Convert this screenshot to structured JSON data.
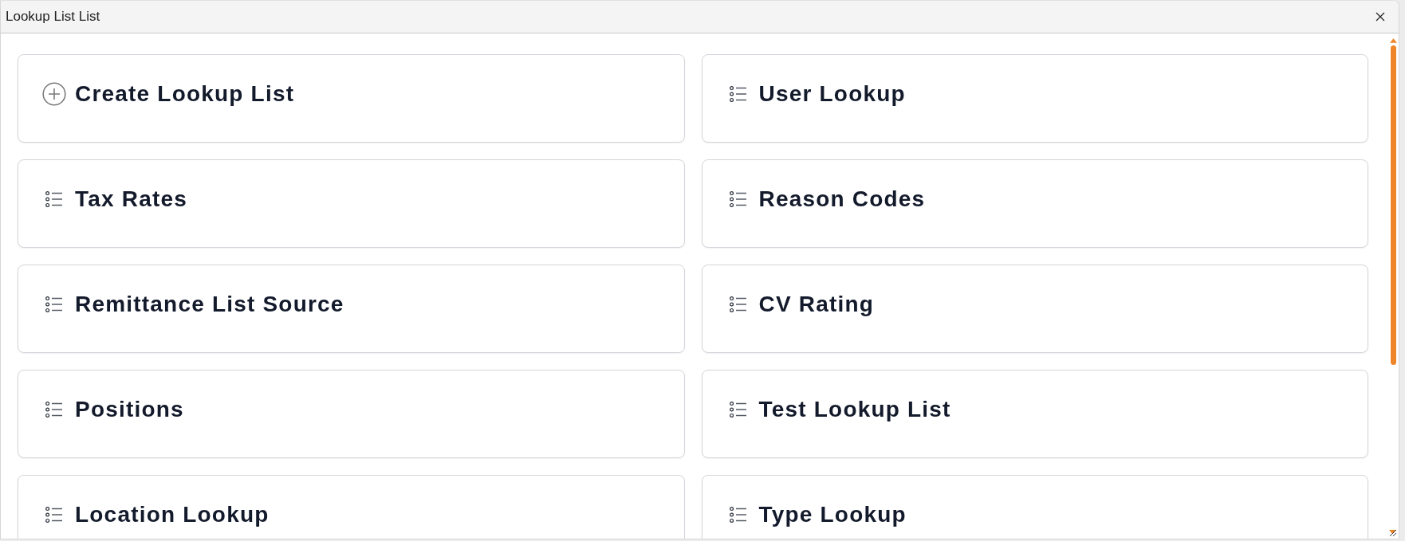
{
  "window": {
    "title": "Lookup List List"
  },
  "cards": [
    {
      "kind": "create",
      "label": "Create Lookup List"
    },
    {
      "kind": "list",
      "label": "User Lookup"
    },
    {
      "kind": "list",
      "label": "Tax Rates"
    },
    {
      "kind": "list",
      "label": "Reason Codes"
    },
    {
      "kind": "list",
      "label": "Remittance List Source"
    },
    {
      "kind": "list",
      "label": "CV Rating"
    },
    {
      "kind": "list",
      "label": "Positions"
    },
    {
      "kind": "list",
      "label": "Test Lookup List"
    },
    {
      "kind": "list",
      "label": "Location Lookup"
    },
    {
      "kind": "list",
      "label": "Type Lookup"
    }
  ]
}
